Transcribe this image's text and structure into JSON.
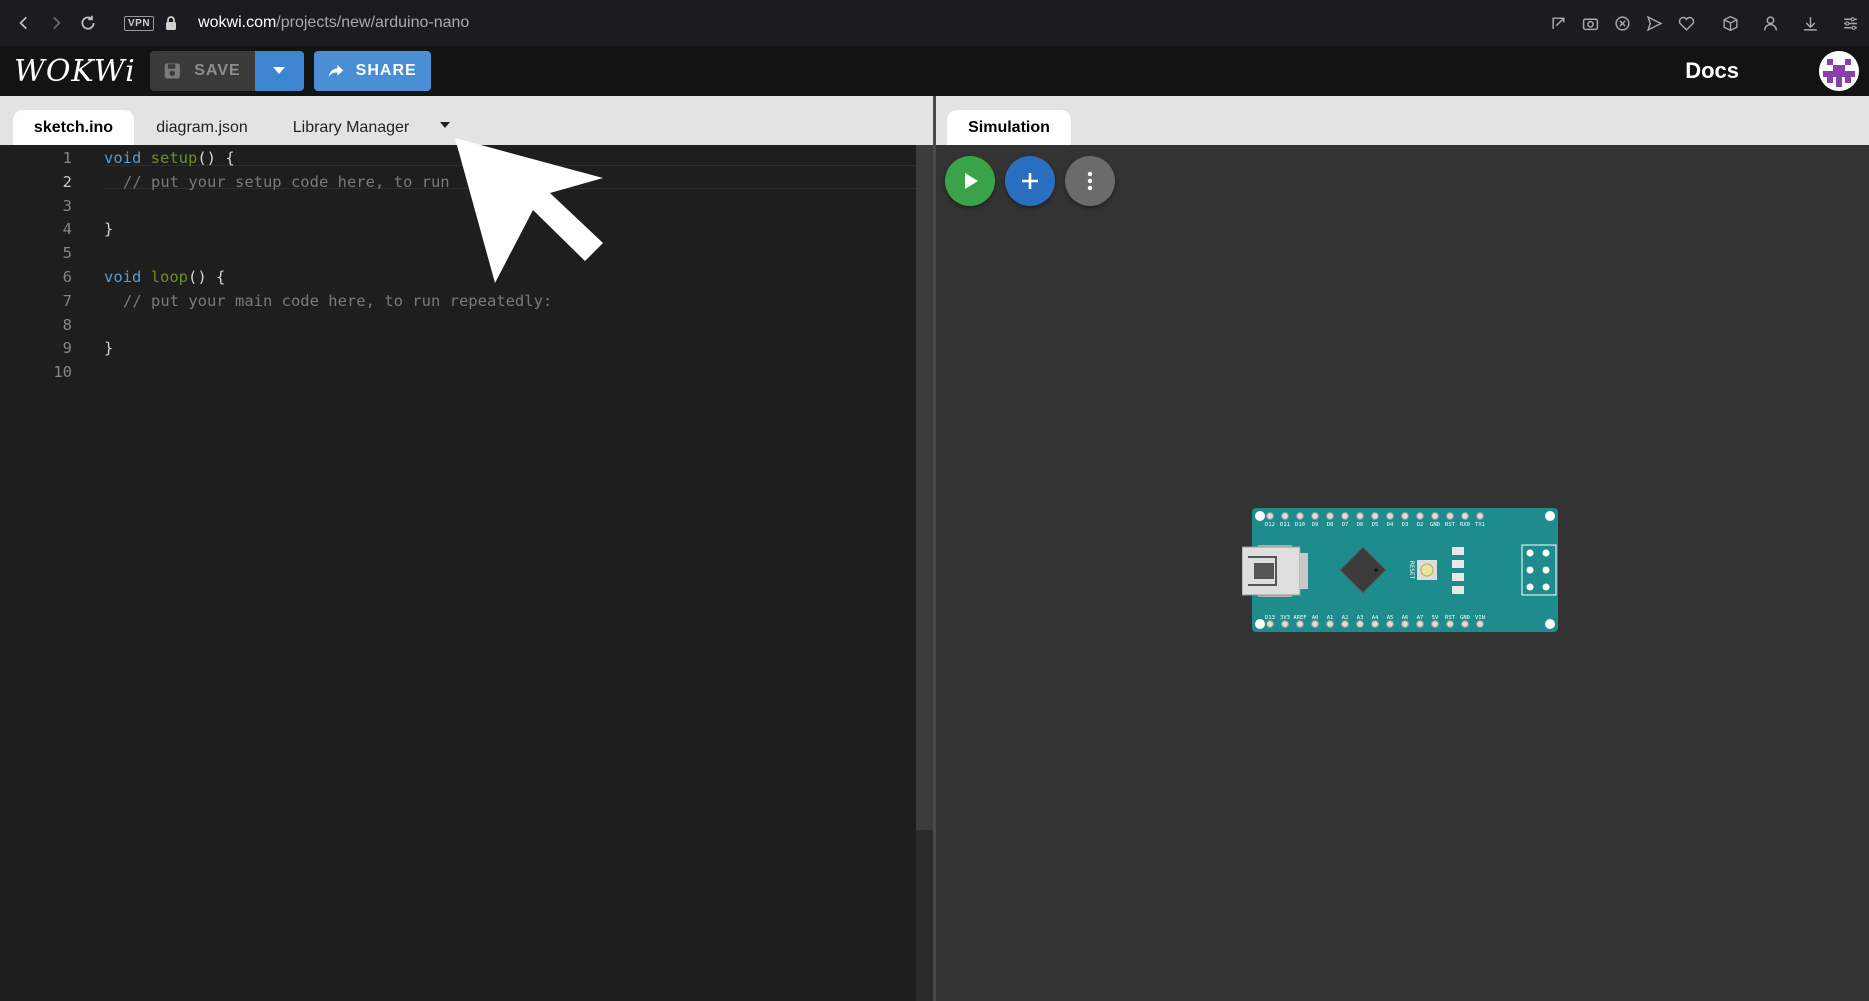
{
  "browser": {
    "vpn_label": "VPN",
    "url_host": "wokwi.com",
    "url_path": "/projects/new/arduino-nano",
    "icons": [
      "back-icon",
      "forward-icon",
      "reload-icon",
      "lock-icon",
      "snapshot-icon",
      "camera-icon",
      "adblock-icon",
      "send-icon",
      "heart-icon",
      "cube-icon",
      "profile-icon",
      "download-icon",
      "settings-icon"
    ]
  },
  "header": {
    "logo": "WOKWi",
    "save_label": "SAVE",
    "share_label": "SHARE",
    "docs_label": "Docs"
  },
  "editor": {
    "tabs": [
      {
        "label": "sketch.ino",
        "active": true
      },
      {
        "label": "diagram.json",
        "active": false
      },
      {
        "label": "Library Manager",
        "active": false
      }
    ],
    "lines": [
      {
        "num": "1"
      },
      {
        "num": "2",
        "comment": "// put your setup code here, to run "
      },
      {
        "num": "3"
      },
      {
        "num": "4",
        "text": "}"
      },
      {
        "num": "5"
      },
      {
        "num": "6"
      },
      {
        "num": "7",
        "comment": "// put your main code here, to run repeatedly:"
      },
      {
        "num": "8"
      },
      {
        "num": "9",
        "text": "}"
      },
      {
        "num": "10"
      }
    ],
    "line1": {
      "kw": "void",
      "fn": "setup",
      "rest": "() {"
    },
    "line6": {
      "kw": "void",
      "fn": "loop",
      "rest": "() {"
    }
  },
  "simulation": {
    "tab_label": "Simulation",
    "buttons": [
      "play-icon",
      "plus-icon",
      "more-vertical-icon"
    ],
    "board": {
      "top_pins": [
        "D12",
        "D11",
        "D10",
        "D9",
        "D8",
        "D7",
        "D6",
        "D5",
        "D4",
        "D3",
        "D2",
        "GND",
        "RST",
        "RX0",
        "TX1"
      ],
      "bottom_pins": [
        "D13",
        "3V3",
        "AREF",
        "A0",
        "A1",
        "A2",
        "A3",
        "A4",
        "A5",
        "A6",
        "A7",
        "5V",
        "RST",
        "GND",
        "VIN"
      ],
      "reset_label": "RESET",
      "led_labels": [
        "TX",
        "RX",
        "ON",
        "L"
      ]
    }
  },
  "colors": {
    "accent_blue": "#4a8fd6",
    "run_green": "#3aa34a",
    "board_teal": "#1e8c8c"
  }
}
